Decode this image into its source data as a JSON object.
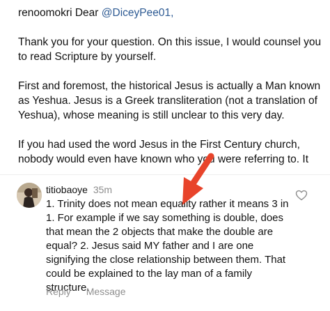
{
  "post": {
    "author": "renoomokri",
    "greeting": "Dear",
    "mention": "@DiceyPee01,",
    "paragraphs": [
      "Thank you for your question. On this issue, I would counsel you to read Scripture by yourself.",
      "First and foremost, the historical Jesus is actually a Man known as Yeshua. Jesus is a Greek transliteration (not a translation of Yeshua), whose meaning is still unclear to this very day."
    ],
    "truncated_line_1": "If you had used the word Jesus in the First Century church,",
    "truncated_line_2": "nobody would even have known who you were referring to. It"
  },
  "comment": {
    "username": "titiobaoye",
    "time": "35m",
    "text": "1. Trinity does not mean equality rather it means 3 in 1. For example if we say something is double, does that mean the 2 objects that make the double are equal? 2. Jesus said MY father and I are one signifying the close relationship between them. That could be explained to the lay man of a family structure.",
    "reply_label": "Reply",
    "message_label": "Message",
    "like_icon": "heart-outline-icon"
  },
  "colors": {
    "mention": "#2d5a93",
    "meta_grey": "#8e8e8e",
    "arrow": "#e8442b"
  }
}
